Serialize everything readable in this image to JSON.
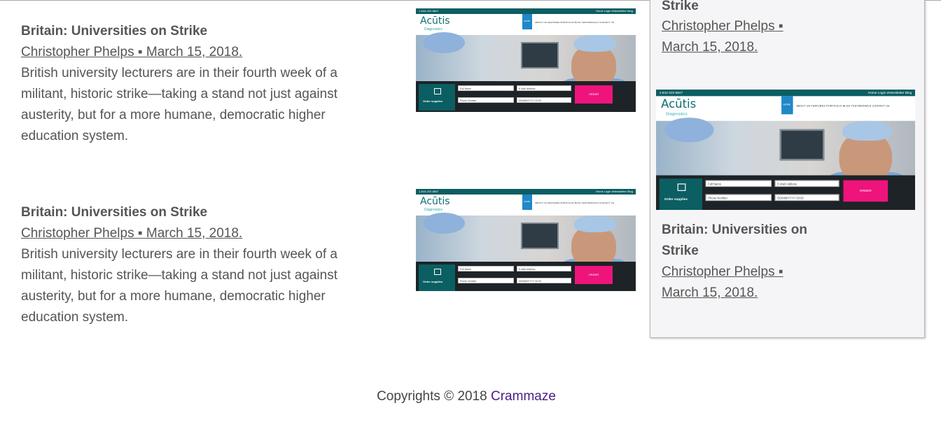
{
  "articles": [
    {
      "title": "Britain: Universities on Strike",
      "byline": "Christopher Phelps ▪ March 15, 2018.",
      "excerpt_lines": [
        "British university lecturers are in their fourth week of a",
        "militant, historic strike—taking a stand not just against",
        "austerity, but for a more humane, democratic higher",
        "education system."
      ]
    },
    {
      "title": "Britain: Universities on Strike",
      "byline": "Christopher Phelps ▪ March 15, 2018.",
      "excerpt_lines": [
        "British university lecturers are in their fourth week of a",
        "militant, historic strike—taking a stand not just against",
        "austerity, but for a more humane, democratic higher",
        "education system."
      ]
    }
  ],
  "sidebar": {
    "top_title_tail": "Strike",
    "top_byline_lines": [
      "Christopher Phelps ▪",
      "March 15, 2018."
    ],
    "card_title_lines": [
      "Britain: Universities on",
      "Strike"
    ],
    "card_byline_lines": [
      "Christopher Phelps ▪",
      "March 15, 2018."
    ]
  },
  "thumbnail": {
    "phone": "1-844-222-8847",
    "top_links": "Home   Login   eNewsletter   Blog",
    "logo": "Acūtis",
    "logo_sub": "Diagnostics",
    "nav_home": "HOME",
    "nav_items": "ABOUT US    FEATURES    PORTFOLIO    BLOG    TESTIMONIALS    CONTACT US",
    "order_label": "Order supplies",
    "field_full_name": "Full Name",
    "field_email": "E-Mail Address",
    "field_phone": "Phone Number",
    "field_date": "DD/MM/YYYY 00:00",
    "order_button": "ORDER",
    "url": "acutisdiagnostics.com/vacuum"
  },
  "footer": {
    "text": "Copyrights © 2018 ",
    "brand": "Crammaze"
  },
  "colors": {
    "brand_link": "#4b1b86",
    "thumb_teal": "#0b5e62",
    "thumb_pink": "#ee147c"
  }
}
